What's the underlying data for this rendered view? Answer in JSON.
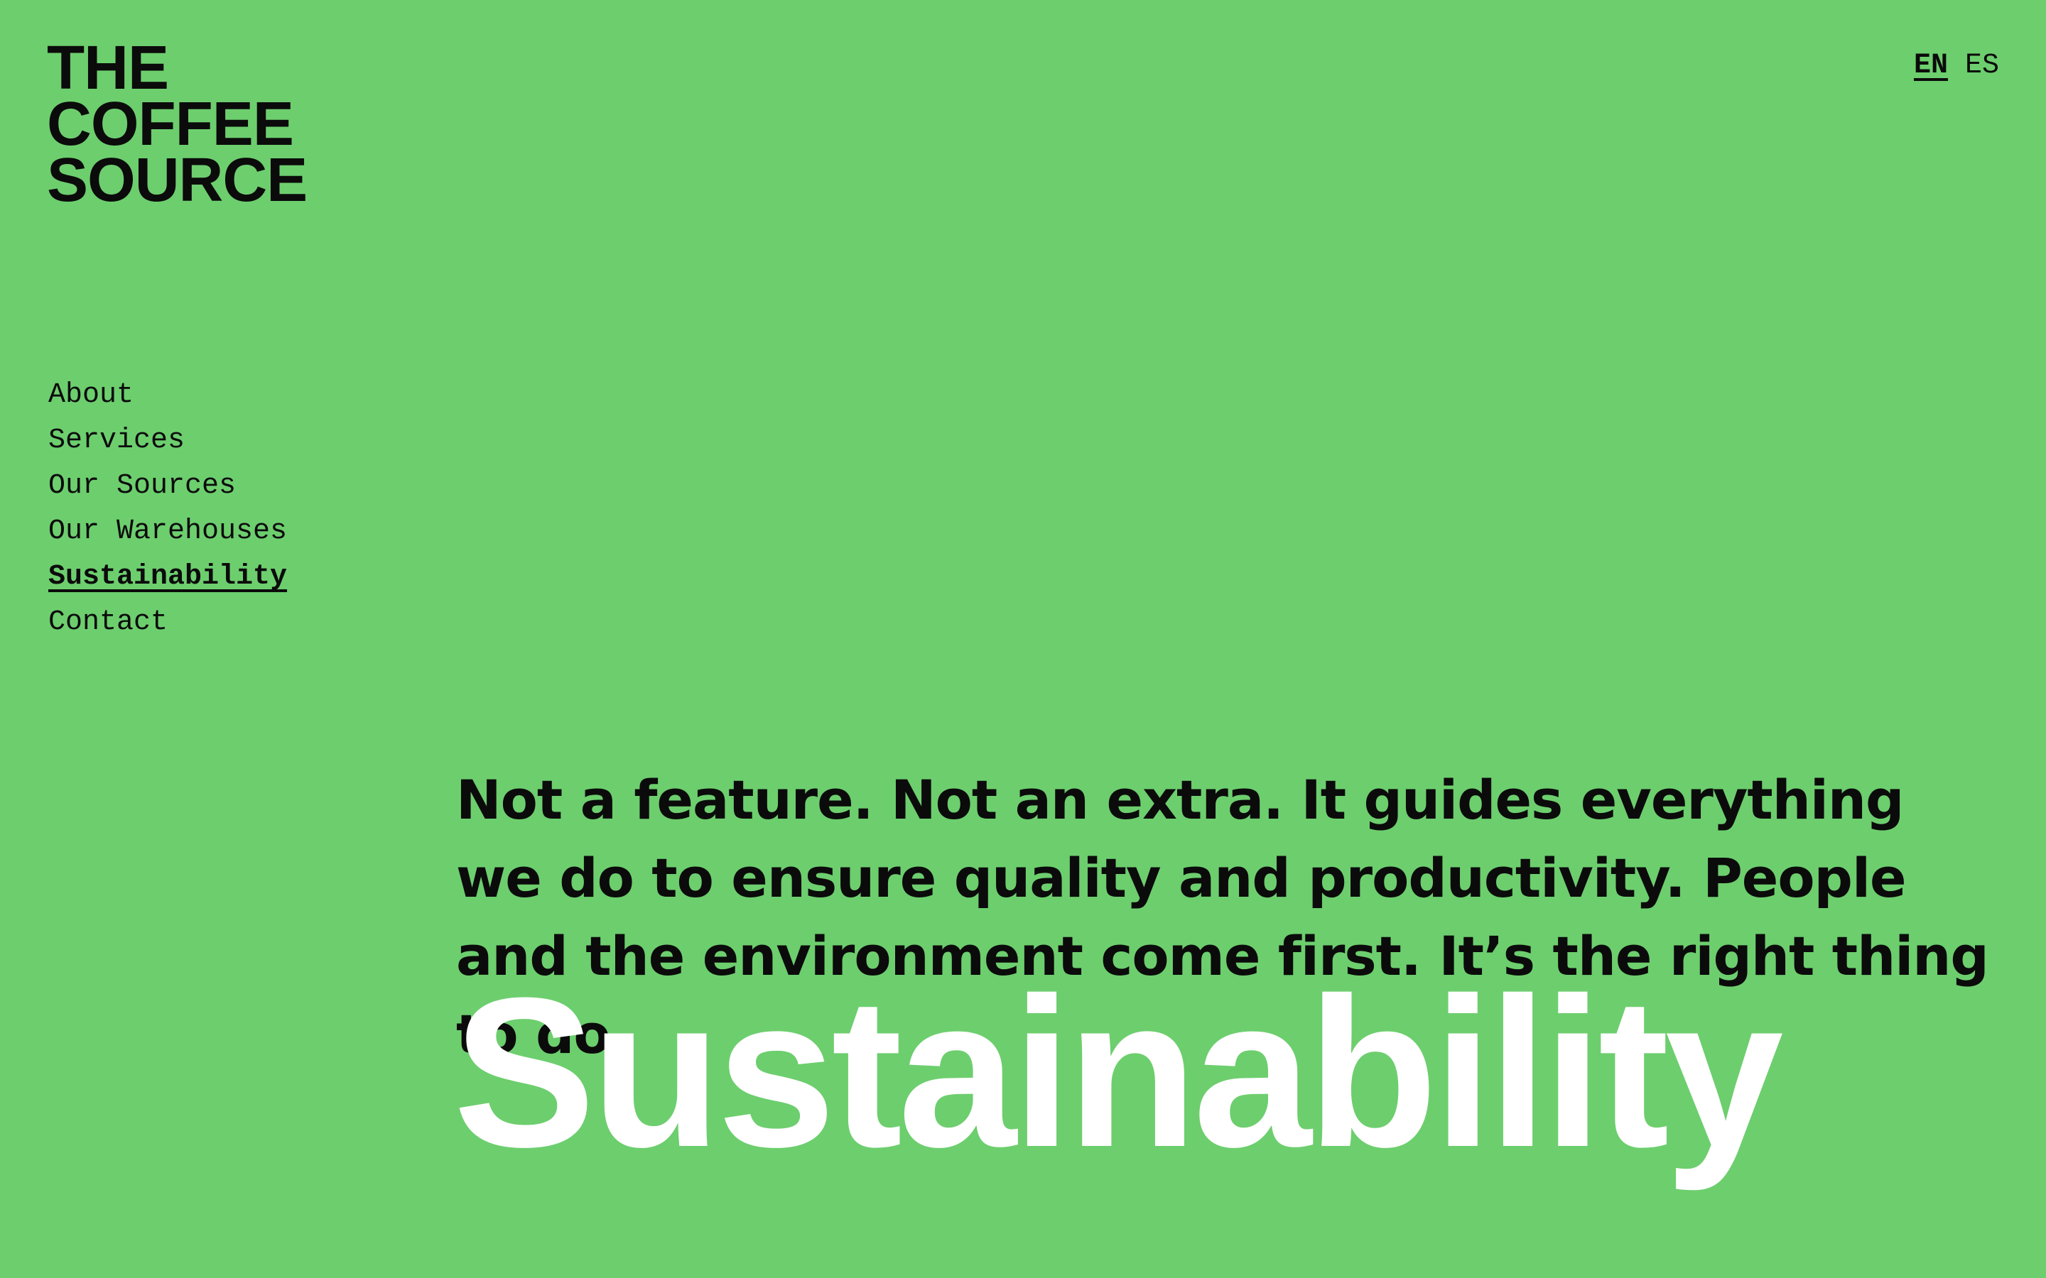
{
  "brand": {
    "logo_lines": [
      "THE",
      "COFFEE",
      "SOURCE"
    ]
  },
  "language": {
    "options": [
      {
        "label": "EN",
        "active": true
      },
      {
        "label": "ES",
        "active": false
      }
    ]
  },
  "nav": {
    "items": [
      {
        "label": "About",
        "active": false
      },
      {
        "label": "Services",
        "active": false
      },
      {
        "label": "Our Sources",
        "active": false
      },
      {
        "label": "Our Warehouses",
        "active": false
      },
      {
        "label": "Sustainability",
        "active": true
      },
      {
        "label": "Contact",
        "active": false
      }
    ]
  },
  "main": {
    "intro": "Not a feature. Not an extra. It guides everything we do to ensure quality and productivity. People and the environment come first. It’s the right thing to do.",
    "title": "Sustainability"
  },
  "colors": {
    "background": "#6dce6e",
    "text": "#0b0b0b",
    "title": "#ffffff"
  }
}
